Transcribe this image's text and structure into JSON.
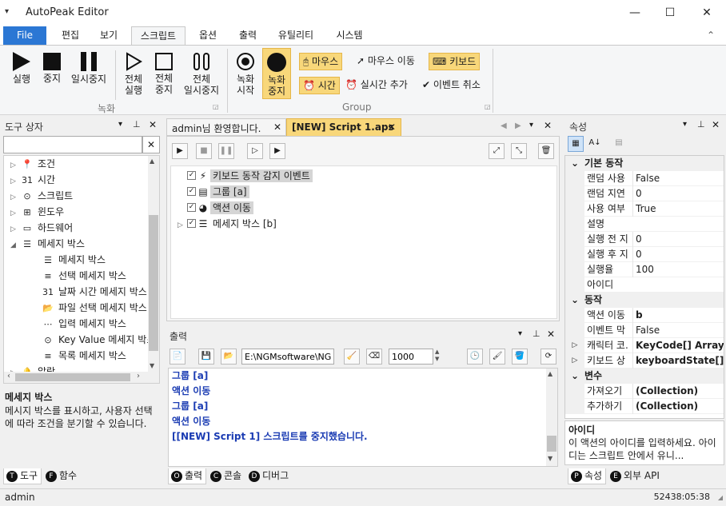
{
  "window": {
    "title": "AutoPeak Editor",
    "menu_glyph": "▾",
    "min": "—",
    "max": "☐",
    "close": "✕"
  },
  "ribbon_tabs": [
    "File",
    "편집",
    "보기",
    "스크립트",
    "옵션",
    "출력",
    "유틸리티",
    "시스템"
  ],
  "ribbon_collapse": "⌃",
  "ribbon": {
    "run": "실행",
    "stop": "중지",
    "pause": "일시중지",
    "run_all": [
      "전체",
      "실행"
    ],
    "stop_all": [
      "전체",
      "중지"
    ],
    "pause_all": [
      "전체",
      "일시중지"
    ],
    "rec_start": [
      "녹화",
      "시작"
    ],
    "rec_stop": [
      "녹화",
      "중지"
    ],
    "mouse": "마우스",
    "mouse_move": "마우스 이동",
    "keyboard": "키보드",
    "time": "시간",
    "realtime_add": "실시간 추가",
    "event_cancel": "이벤트 취소",
    "group1_label": "녹화",
    "group2_label": "Group"
  },
  "toolbox": {
    "title": "도구 상자",
    "search_value": "",
    "items": [
      {
        "arrow": "▷",
        "icon": "📍",
        "label": "조건",
        "indent": 0
      },
      {
        "arrow": "▷",
        "icon": "31",
        "label": "시간",
        "indent": 0
      },
      {
        "arrow": "▷",
        "icon": "⊙",
        "label": "스크립트",
        "indent": 0
      },
      {
        "arrow": "▷",
        "icon": "⊞",
        "label": "윈도우",
        "indent": 0
      },
      {
        "arrow": "▷",
        "icon": "▭",
        "label": "하드웨어",
        "indent": 0
      },
      {
        "arrow": "◢",
        "icon": "☰",
        "label": "메세지 박스",
        "indent": 0
      },
      {
        "arrow": "",
        "icon": "☰",
        "label": "메세지 박스",
        "indent": 1
      },
      {
        "arrow": "",
        "icon": "≡",
        "label": "선택 메세지 박스",
        "indent": 1
      },
      {
        "arrow": "",
        "icon": "31",
        "label": "날짜 시간 메세지 박스",
        "indent": 1
      },
      {
        "arrow": "",
        "icon": "📂",
        "label": "파일 선택 메세지 박스",
        "indent": 1
      },
      {
        "arrow": "",
        "icon": "⋯",
        "label": "입력 메세지 박스",
        "indent": 1
      },
      {
        "arrow": "",
        "icon": "⊙",
        "label": "Key Value 메세지 박스",
        "indent": 1
      },
      {
        "arrow": "",
        "icon": "≡",
        "label": "목록 메세지 박스",
        "indent": 1
      },
      {
        "arrow": "▷",
        "icon": "🔔",
        "label": "알람",
        "indent": 0
      }
    ],
    "desc_title": "메세지 박스",
    "desc_text": "메시지 박스를 표시하고, 사용자 선택에 따라 조건을 분기할 수 있습니다.",
    "tabs": [
      {
        "dot": "T",
        "label": "도구"
      },
      {
        "dot": "F",
        "label": "함수"
      }
    ]
  },
  "editor": {
    "tabs": [
      "admin님 환영합니다.",
      "[NEW] Script 1.aps"
    ],
    "tree": [
      {
        "arrow": "",
        "icon": "⚡",
        "label": "키보드 동작 감지 이벤트",
        "highlight": true
      },
      {
        "arrow": "",
        "icon": "▤",
        "label": "그룹 [a]",
        "highlight": true
      },
      {
        "arrow": "",
        "icon": "◕",
        "label": "액션 이동",
        "highlight": true
      },
      {
        "arrow": "▷",
        "icon": "☰",
        "label": "메세지 박스 [b]",
        "highlight": false
      }
    ]
  },
  "output": {
    "title": "출력",
    "path": "E:\\NGMsoftware\\NG",
    "count": "1000",
    "lines": [
      "그룹 [a]",
      "액션 이동",
      "그룹 [a]",
      "액션 이동",
      "[[NEW] Script 1] 스크립트를 중지했습니다."
    ],
    "tabs": [
      {
        "dot": "O",
        "label": "출력"
      },
      {
        "dot": "C",
        "label": "콘솔"
      },
      {
        "dot": "D",
        "label": "디버그"
      }
    ]
  },
  "props": {
    "title": "속성",
    "rows": [
      {
        "type": "cat",
        "label": "기본 동작"
      },
      {
        "type": "row",
        "name": "랜덤 사용",
        "value": "False",
        "bold": false
      },
      {
        "type": "row",
        "name": "랜덤 지연",
        "value": "0",
        "bold": false
      },
      {
        "type": "row",
        "name": "사용 여부",
        "value": "True",
        "bold": false
      },
      {
        "type": "row",
        "name": "설명",
        "value": "",
        "bold": false
      },
      {
        "type": "row",
        "name": "실행 전 지",
        "value": "0",
        "bold": false
      },
      {
        "type": "row",
        "name": "실행 후 지",
        "value": "0",
        "bold": false
      },
      {
        "type": "row",
        "name": "실행율",
        "value": "100",
        "bold": false
      },
      {
        "type": "row",
        "name": "아이디",
        "value": "",
        "bold": false
      },
      {
        "type": "cat",
        "label": "동작"
      },
      {
        "type": "row",
        "name": "액션 이동",
        "value": "b",
        "bold": true
      },
      {
        "type": "row",
        "name": "이벤트 막",
        "value": "False",
        "bold": false
      },
      {
        "type": "exp",
        "name": "캐릭터 코.",
        "value": "KeyCode[] Array",
        "bold": true
      },
      {
        "type": "exp",
        "name": "키보드 상",
        "value": "keyboardState[] Ar",
        "bold": true
      },
      {
        "type": "cat",
        "label": "변수"
      },
      {
        "type": "row",
        "name": "가져오기",
        "value": "(Collection)",
        "bold": true
      },
      {
        "type": "row",
        "name": "추가하기",
        "value": "(Collection)",
        "bold": true
      }
    ],
    "desc_title": "아이디",
    "desc_text": "이 액션의 아이디를 입력하세요. 아이디는 스크립트 안에서 유니...",
    "tabs": [
      {
        "dot": "P",
        "label": "속성"
      },
      {
        "dot": "E",
        "label": "외부 API"
      }
    ]
  },
  "status": {
    "user": "admin",
    "time": "52438:05:38"
  },
  "colors": {
    "accent": "#2b77d4",
    "highlight": "#f8d77a",
    "output_text": "#1b3cb3"
  }
}
